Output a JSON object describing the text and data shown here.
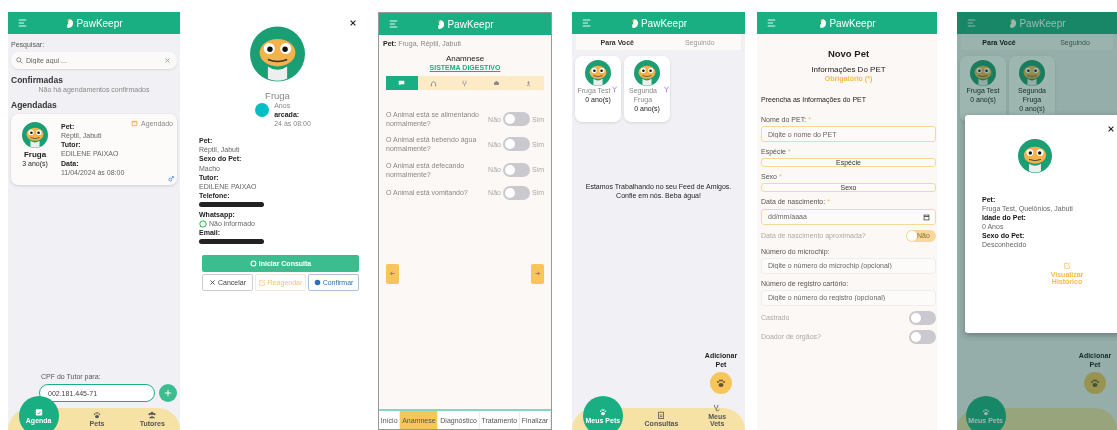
{
  "agenda_screen": {
    "app_name": "PawKeepr",
    "search_label": "Pesquisar:",
    "search_placeholder": "Digite aqui ...",
    "confirmed_title": "Confirmadas",
    "confirmed_empty": "Não há agendamentos confirmados",
    "scheduled_title": "Agendadas",
    "appointment": {
      "pet_name": "Fruga",
      "pet_age": "3 ano(s)",
      "status": "Agendado",
      "fields": [
        {
          "label": "Pet:",
          "value": "Réptil, Jabuti"
        },
        {
          "label": "Tutor:",
          "value": "EDILENE PAIXAO"
        },
        {
          "label": "Data:",
          "value": "11/04/2024 às 08:00"
        }
      ]
    },
    "cpf_label": "CPF do Tutor para:",
    "cpf_value": "002.181.445-71",
    "nav": [
      {
        "label": "Agenda",
        "selected": true
      },
      {
        "label": "Pets",
        "selected": false
      },
      {
        "label": "Tutores",
        "selected": false
      }
    ]
  },
  "appointment_detail": {
    "pet_name": "Fruga",
    "age_fragment": "Anos",
    "date_label_fragment": "arcada:",
    "date_fragment": "24 às 08:00",
    "fields": [
      {
        "label": "Pet:",
        "kind": "text",
        "value": "Réptil, Jabuti"
      },
      {
        "label": "Sexo do Pet:",
        "kind": "text",
        "value": "Macho"
      },
      {
        "label": "Tutor:",
        "kind": "text",
        "value": "EDILENE PAIXAO"
      },
      {
        "label": "Telefone:",
        "kind": "redacted"
      },
      {
        "label": "Whatsapp:",
        "kind": "whatsapp",
        "value": "Não informado"
      },
      {
        "label": "Email:",
        "kind": "redacted"
      }
    ],
    "buttons": [
      {
        "label": "Iniciar Consulta",
        "kind": "primary"
      },
      {
        "label": "Cancelar",
        "kind": "cancel"
      },
      {
        "label": "Reagendar",
        "kind": "reschedule"
      },
      {
        "label": "Confirmar",
        "kind": "confirm"
      }
    ]
  },
  "anamnesis_screen": {
    "app_name": "PawKeepr",
    "pet_label": "Pet:",
    "pet_value": "Fruga, Réptil, Jabuti",
    "title": "Anamnese",
    "subtitle": "SISTEMA DIGESTIVO",
    "system_tabs": [
      {
        "selected": true
      },
      {
        "selected": false
      },
      {
        "selected": false
      },
      {
        "selected": false
      },
      {
        "selected": false
      }
    ],
    "questions": [
      {
        "text": "O Animal está se alimentando normalmente?",
        "no_label": "Não",
        "yes_label": "Sim",
        "on": false
      },
      {
        "text": "O Animal está bebendo água normalmente?",
        "no_label": "Não",
        "yes_label": "Sim",
        "on": false
      },
      {
        "text": "O Animal está defecando normalmente?",
        "no_label": "Não",
        "yes_label": "Sim",
        "on": false
      },
      {
        "text": "O Animal está vomitando?",
        "no_label": "Não",
        "yes_label": "Sim",
        "on": false
      }
    ],
    "steps": [
      {
        "label": "Início",
        "selected": false
      },
      {
        "label": "Anamnese",
        "selected": true
      },
      {
        "label": "Diagnóstico",
        "selected": false
      },
      {
        "label": "Tratamento",
        "selected": false
      },
      {
        "label": "Finalizar",
        "selected": false
      }
    ]
  },
  "feed_screen": {
    "app_name": "PawKeepr",
    "tabs": [
      {
        "label": "Para Você",
        "selected": true
      },
      {
        "label": "Seguindo",
        "selected": false
      }
    ],
    "pets": [
      {
        "name": "Fruga Test",
        "age": "0 ano(s)"
      },
      {
        "name": "Segunda Fruga",
        "age": "0 ano(s)"
      }
    ],
    "message": "Estamos Trabalhando no seu Feed de Amigos. Confie em nós. Beba água!",
    "add_label": "Adicionar Pet",
    "nav": [
      {
        "label": "Meus Pets",
        "selected": true
      },
      {
        "label": "Consultas",
        "selected": false
      },
      {
        "label": "Meus Vets",
        "selected": false
      }
    ]
  },
  "new_pet_form": {
    "app_name": "PawKeepr",
    "title": "Novo Pet",
    "section_title": "Informações Do PET",
    "required_note": "Obrigatório (*)",
    "intro": "Preencha as Informações do PET",
    "fields": [
      {
        "kind": "text",
        "label": "Nome do PET:",
        "required_mark": "*",
        "placeholder": "Digite o nome do PET"
      },
      {
        "kind": "select",
        "label": "Espécie",
        "required_mark": "*",
        "value": "Espécie"
      },
      {
        "kind": "select",
        "label": "Sexo",
        "required_mark": "*",
        "value": "Sexo"
      },
      {
        "kind": "date",
        "label": "Data de nascimento:",
        "required_mark": "*",
        "placeholder": "dd/mm/aaaa"
      },
      {
        "kind": "toggle",
        "label": "Data de nascimento aproximada?",
        "on": false,
        "toggle_label": "Não"
      },
      {
        "kind": "text",
        "label": "Número do microchip:",
        "placeholder": "Digite o número do microchip (opcional)"
      },
      {
        "kind": "text",
        "label": "Número de registro cartório:",
        "placeholder": "Digite o número do registro (opcional)"
      },
      {
        "kind": "toggle",
        "label": "Castrado",
        "on": false
      },
      {
        "kind": "toggle",
        "label": "Doador de órgãos?",
        "on": false
      }
    ]
  },
  "pet_modal_screen": {
    "app_name": "PawKeepr",
    "tabs": [
      {
        "label": "Para Você",
        "selected": true
      },
      {
        "label": "Seguindo",
        "selected": false
      }
    ],
    "pets": [
      {
        "name": "Fruga Test",
        "age": "0 ano(s)"
      },
      {
        "name": "Segunda Fruga",
        "age": "0 ano(s)"
      }
    ],
    "add_label": "Adicionar Pet",
    "nav_label": "Meus Pets",
    "modal": {
      "fields": [
        {
          "label": "Pet:",
          "value": "Fruga Test, Quelônios, Jabuti"
        },
        {
          "label": "Idade do Pet:",
          "value": "0 Anos"
        },
        {
          "label": "Sexo do Pet:",
          "value": "Desconhecido"
        }
      ],
      "history_link": "Visualizar Histórico"
    }
  }
}
